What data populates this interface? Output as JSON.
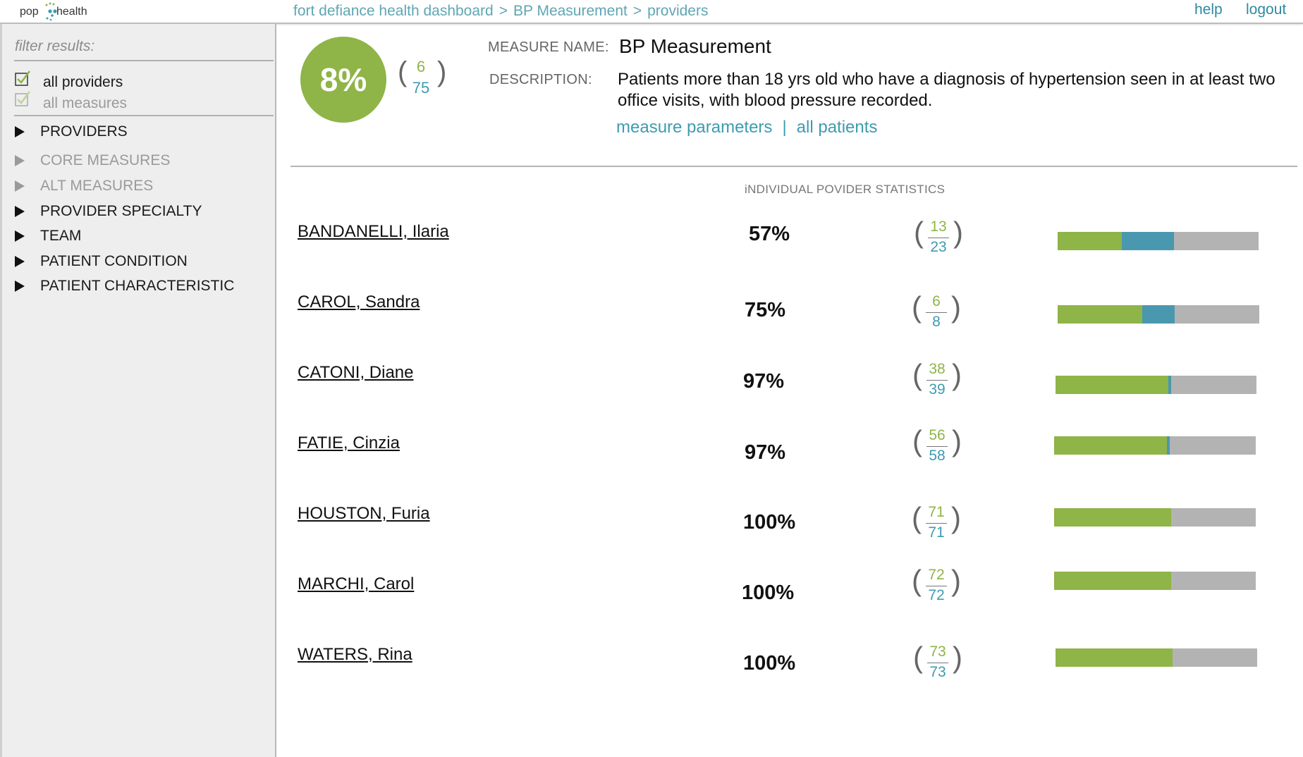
{
  "header": {
    "logo": {
      "left": "pop",
      "right": "health"
    },
    "breadcrumb": [
      "fort defiance health dashboard",
      "BP Measurement",
      "providers"
    ],
    "breadcrumb_sep": ">",
    "help": "help",
    "logout": "logout"
  },
  "sidebar": {
    "filter_title": "filter results:",
    "checkboxes": [
      {
        "label": "all providers",
        "checked": true,
        "enabled": true
      },
      {
        "label": "all measures",
        "checked": true,
        "enabled": false
      }
    ],
    "tree": [
      {
        "label": "PROVIDERS",
        "enabled": true
      },
      {
        "label": "CORE MEASURES",
        "enabled": false
      },
      {
        "label": "ALT MEASURES",
        "enabled": false
      },
      {
        "label": "PROVIDER SPECIALTY",
        "enabled": true
      },
      {
        "label": "TEAM",
        "enabled": true
      },
      {
        "label": "PATIENT CONDITION",
        "enabled": true
      },
      {
        "label": "PATIENT CHARACTERISTIC",
        "enabled": true
      }
    ]
  },
  "summary": {
    "percent": "8%",
    "numerator": "6",
    "denominator": "75",
    "measure_name_label": "MEASURE NAME:",
    "measure_name": "BP Measurement",
    "description_label": "DESCRIPTION:",
    "description": "Patients more than 18 yrs old who have a diagnosis of hypertension seen in at least two office visits, with blood pressure recorded.",
    "link_parameters": "measure parameters",
    "link_sep": "|",
    "link_patients": "all patients"
  },
  "stats_title": "iNDIVIDUAL POVIDER STATISTICS",
  "providers": [
    {
      "name": "BANDANELLI, Ilaria",
      "percent": "57%",
      "numerator": "13",
      "denominator": "23",
      "green": 0.32,
      "blue": 0.26
    },
    {
      "name": "CAROL, Sandra",
      "percent": "75%",
      "numerator": "6",
      "denominator": "8",
      "green": 0.42,
      "blue": 0.16
    },
    {
      "name": "CATONI, Diane",
      "percent": "97%",
      "numerator": "38",
      "denominator": "39",
      "green": 0.56,
      "blue": 0.015
    },
    {
      "name": "FATIE, Cinzia",
      "percent": "97%",
      "numerator": "56",
      "denominator": "58",
      "green": 0.56,
      "blue": 0.015
    },
    {
      "name": "HOUSTON, Furia",
      "percent": "100%",
      "numerator": "71",
      "denominator": "71",
      "green": 0.58,
      "blue": 0
    },
    {
      "name": "MARCHI, Carol",
      "percent": "100%",
      "numerator": "72",
      "denominator": "72",
      "green": 0.58,
      "blue": 0
    },
    {
      "name": "WATERS, Rina",
      "percent": "100%",
      "numerator": "73",
      "denominator": "73",
      "green": 0.58,
      "blue": 0
    }
  ],
  "colors": {
    "green": "#8fb447",
    "blue": "#4a98af",
    "gray": "#b3b3b3",
    "teal_text": "#3e9bb0"
  }
}
